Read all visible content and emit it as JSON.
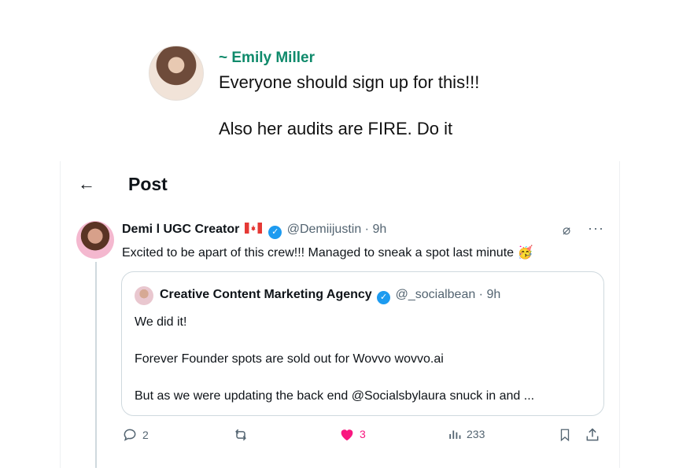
{
  "message": {
    "author": "~ Emily Miller",
    "lines": [
      "Everyone should sign up for this!!!",
      "Also her audits are FIRE. Do it"
    ]
  },
  "post": {
    "back_glyph": "←",
    "title": "Post",
    "author_name": "Demi l UGC Creator",
    "handle_time": "@Demiijustin · 9h",
    "text": "Excited to be apart of this crew!!! Managed to sneak a spot last minute",
    "emoji": "🥳",
    "quote": {
      "author_name": "Creative Content Marketing Agency",
      "handle_time": "@_socialbean · 9h",
      "lines": [
        "We did it!",
        "Forever Founder spots are sold out for Wovvo wovvo.ai",
        "But as we were updating the back end @Socialsbylaura snuck in and ..."
      ]
    },
    "stats": {
      "replies": "2",
      "likes": "3",
      "views": "233"
    },
    "colors": {
      "accent_verified": "#1d9bf0",
      "like": "#f91880",
      "author_green": "#0f8a6b"
    }
  }
}
